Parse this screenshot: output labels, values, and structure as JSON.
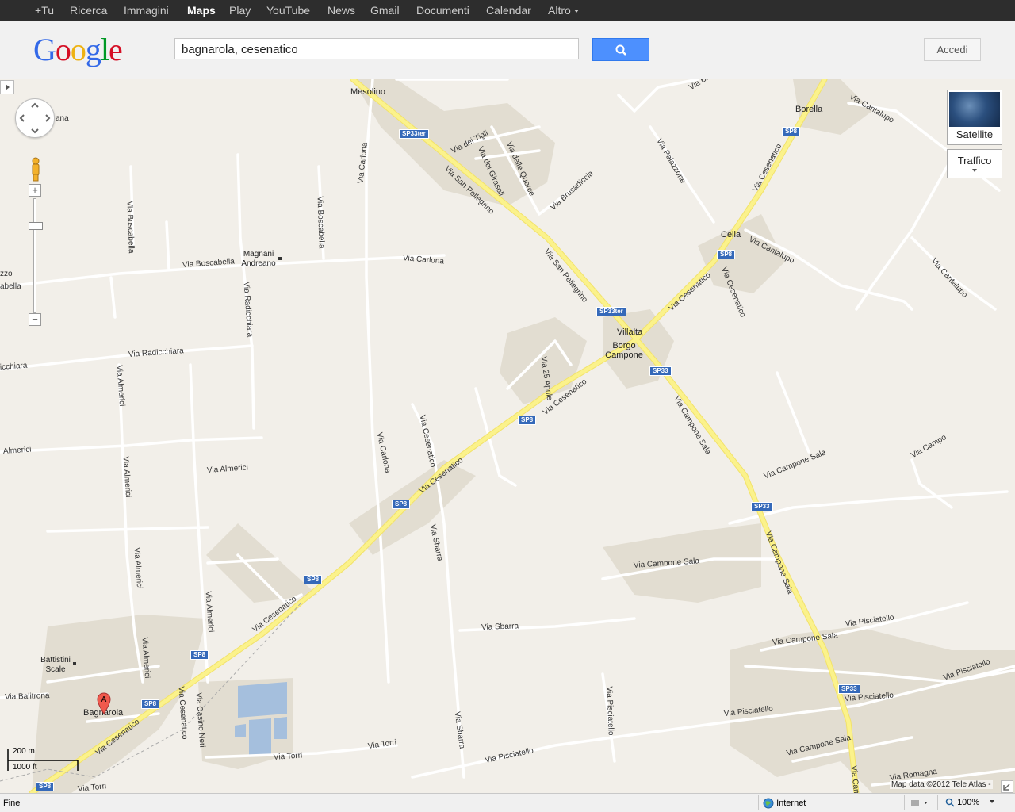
{
  "gbar": {
    "items": [
      "+Tu",
      "Ricerca",
      "Immagini",
      "Maps",
      "Play",
      "YouTube",
      "News",
      "Gmail",
      "Documenti",
      "Calendar",
      "Altro"
    ],
    "active": "Maps"
  },
  "header": {
    "logo": "Google",
    "search_value": "bagnarola, cesenatico",
    "signin_label": "Accedi"
  },
  "map": {
    "controls": {
      "zoom_in": "+",
      "zoom_out": "−",
      "satellite_label": "Satellite",
      "traffic_label": "Traffico"
    },
    "places": {
      "mesolino": "Mesolino",
      "borella": "Borella",
      "cella": "Cella",
      "villalta": "Villalta",
      "borgo_campone": "Borgo Campone",
      "magnani": "Magnani Andreano",
      "battistini": "Battistini Scale",
      "bagnarola": "Bagnarola"
    },
    "roads": {
      "via_san_pellegrino": "Via San Pellegrino",
      "via_cesenatico": "Via Cesenatico",
      "via_campone_sala": "Via Campone Sala",
      "via_cantalupo": "Via Cantalupo",
      "via_carlona": "Via Carlona",
      "via_boscabella": "Via Boscabella",
      "via_radicchiara": "Via Radicchiara",
      "via_almerici": "Via Almerici",
      "via_sbarra": "Via Sbarra",
      "via_pisciatello": "Via Pisciatello",
      "via_torri": "Via Torri",
      "via_balitrona": "Via Balitrona",
      "via_casino_neri": "Via Casino Neri",
      "via_brusadiccia": "Via Brusadiccia",
      "via_palazzone": "Via Palazzone",
      "via_dei_tigli": "Via dei Tigli",
      "via_dei_girasoli": "Via dei Girasoli",
      "via_delle_querce": "Via delle Querce",
      "via_25_aprile": "Via 25 Aprile",
      "via_romagna": "Via Romagna",
      "via_cesenatico_short": "Via Cesenatico",
      "via_bru": "Via Bru",
      "via_almerici_short": "Almerici",
      "via_radicchiara_short": "icchiara",
      "zzo": "zzo",
      "abella": "abella",
      "via_campo": "Via Campo",
      "ana": "ana"
    },
    "shields": {
      "sp8": "SP8",
      "sp33": "SP33",
      "sp33ter": "SP33ter"
    },
    "marker_letter": "A",
    "scale": {
      "metric": "200 m",
      "imperial": "1000 ft"
    },
    "copyright": "Map data ©2012 Tele Atlas -"
  },
  "status": {
    "text": "Fine",
    "zone": "Internet",
    "zoom": "100%"
  },
  "colors": {
    "map_bg": "#f2efe9",
    "urban": "#e2ddd1",
    "road_major": "#fbf28b",
    "water": "#a5bfdd",
    "accent": "#4d90fe"
  }
}
